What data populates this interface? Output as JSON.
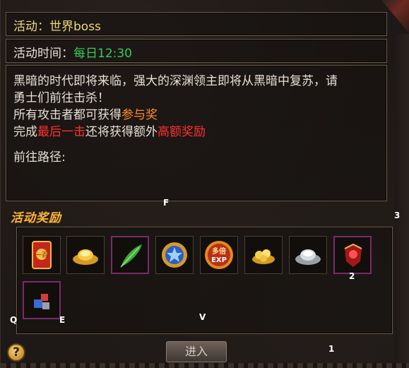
{
  "activity": {
    "label": "活动：",
    "name": "世界boss"
  },
  "time": {
    "label": "活动时间：",
    "value": "每日12:30"
  },
  "description": {
    "line1": "黑暗的时代即将来临，强大的深渊领主即将从黑暗中复苏，请",
    "line2": "勇士们前往击杀！",
    "line3_a": "所有攻击者都可获得",
    "line3_b": "参与奖",
    "line4_a": "完成",
    "line4_b": "最后一击",
    "line4_c": "还将获得额外",
    "line4_d": "高额奖励",
    "route_label": "前往路径:"
  },
  "rewards": {
    "title": "活动奖励",
    "items": [
      {
        "name": "red-envelope-icon",
        "text": "一百"
      },
      {
        "name": "gold-ingot-icon"
      },
      {
        "name": "green-feather-icon"
      },
      {
        "name": "blue-medal-icon"
      },
      {
        "name": "multi-exp-icon",
        "text1": "多倍",
        "text2": "EXP"
      },
      {
        "name": "gold-coins-icon"
      },
      {
        "name": "silver-ingot-icon"
      },
      {
        "name": "red-gem-armor-icon"
      },
      {
        "name": "blue-crystal-icon"
      }
    ]
  },
  "overlay_letters": {
    "f": "F",
    "three": "3",
    "two": "2",
    "q": "Q",
    "e": "E",
    "v": "V",
    "one": "1"
  },
  "buttons": {
    "help": "?",
    "enter": "进入"
  },
  "colors": {
    "highlight_yellow": "#ecd77a",
    "time_green": "#38c95a",
    "participation_orange": "#ff8a2a",
    "bonus_red": "#ff3131",
    "reward_title_gold": "#f0b845"
  }
}
